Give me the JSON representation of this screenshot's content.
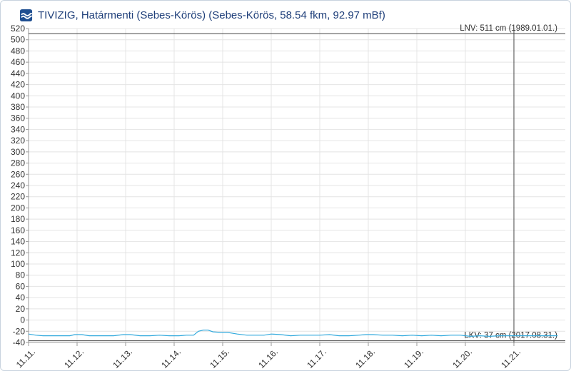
{
  "title": "TIVIZIG, Határmenti (Sebes-Körös) (Sebes-Körös, 58.54 fkm, 92.97 mBf)",
  "logo_icon": "tivizig-logo-icon",
  "colors": {
    "series": "#33aadd",
    "title": "#1f3f7a",
    "grid": "#e4e4e4",
    "reference": "#444444"
  },
  "chart_data": {
    "type": "line",
    "title": "TIVIZIG, Határmenti (Sebes-Körös) (Sebes-Körös, 58.54 fkm, 92.97 mBf)",
    "xlabel": "",
    "ylabel": "",
    "ylim": [
      -40,
      520
    ],
    "xlim": [
      0,
      10.9
    ],
    "yticks": [
      520,
      500,
      480,
      460,
      440,
      420,
      400,
      380,
      360,
      340,
      320,
      300,
      280,
      260,
      240,
      220,
      200,
      180,
      160,
      140,
      120,
      100,
      80,
      60,
      40,
      20,
      0,
      -20,
      -40
    ],
    "xtick_labels": [
      "11.11.",
      "11.12.",
      "11.13.",
      "11.14.",
      "11.15.",
      "11.16.",
      "11.17.",
      "11.18.",
      "11.19.",
      "11.20.",
      "11.21."
    ],
    "grid": true,
    "reference_lines": [
      {
        "label": "LNV: 511 cm (1989.01.01.)",
        "value": 511
      },
      {
        "label": "LKV: 37 cm (2017.08.31.)",
        "value": -37
      }
    ],
    "vertical_marker_x": 10.0,
    "series": [
      {
        "x": [
          0,
          0.15,
          0.3,
          0.5,
          0.7,
          0.85,
          0.95,
          1.1,
          1.25,
          1.5,
          1.75,
          1.95,
          2.1,
          2.3,
          2.5,
          2.7,
          2.9,
          3.1,
          3.25,
          3.4,
          3.5,
          3.6,
          3.7,
          3.8,
          3.95,
          4.1,
          4.3,
          4.5,
          4.7,
          4.85,
          5.0,
          5.2,
          5.4,
          5.6,
          5.8,
          6.0,
          6.2,
          6.4,
          6.6,
          6.8,
          6.95,
          7.1,
          7.3,
          7.5,
          7.7,
          7.9,
          8.1,
          8.3,
          8.5,
          8.7,
          8.9,
          9.1,
          9.3,
          9.5,
          9.7,
          9.9,
          10.1,
          10.3,
          10.5,
          10.7,
          10.9
        ],
        "y": [
          -25,
          -27,
          -28,
          -28,
          -28,
          -28,
          -26,
          -26,
          -28,
          -28,
          -28,
          -26,
          -26,
          -28,
          -28,
          -27,
          -28,
          -28,
          -27,
          -27,
          -20,
          -18,
          -18,
          -21,
          -22,
          -22,
          -25,
          -27,
          -27,
          -27,
          -25,
          -26,
          -28,
          -27,
          -27,
          -27,
          -26,
          -28,
          -28,
          -27,
          -26,
          -26,
          -27,
          -27,
          -28,
          -27,
          -28,
          -27,
          -28,
          -27,
          -27,
          -29,
          -28,
          -29,
          -28,
          -28,
          -28,
          -28,
          -28,
          -28,
          -28
        ]
      }
    ]
  }
}
